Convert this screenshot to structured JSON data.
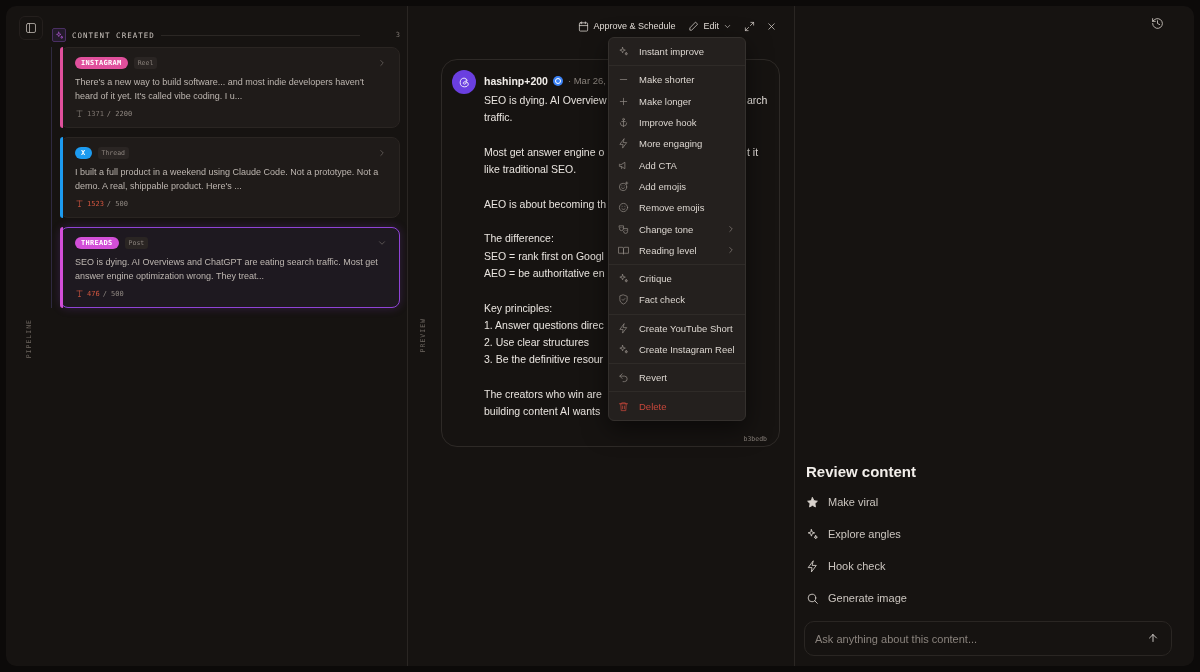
{
  "pipeline": {
    "label": "PIPELINE",
    "section": {
      "title": "CONTENT CREATED",
      "count": "3"
    },
    "cards": [
      {
        "platform": "INSTAGRAM",
        "type": "Reel",
        "color": "#e0509c",
        "selected": false,
        "alert": false,
        "text": "There's a new way to build software... and most indie developers haven't heard of it yet. It's called vibe coding. I u...",
        "count": "1371",
        "limit": "/ 2200"
      },
      {
        "platform": "X",
        "type": "Thread",
        "color": "#1d9bf0",
        "selected": false,
        "alert": true,
        "text": "I built a full product in a weekend using Claude Code. Not a prototype. Not a demo. A real, shippable product. Here's ...",
        "count": "1523",
        "limit": "/ 500"
      },
      {
        "platform": "THREADS",
        "type": "Post",
        "color": "#d24fd8",
        "selected": true,
        "alert": true,
        "text": "SEO is dying. AI Overviews and ChatGPT are eating search traffic. Most get answer engine optimization wrong. They treat...",
        "count": "476",
        "limit": "/ 500"
      }
    ]
  },
  "preview": {
    "label": "PREVIEW",
    "toolbar": {
      "approve": "Approve & Schedule",
      "edit": "Edit"
    },
    "post": {
      "author": "hashinp+200",
      "date": "· Mar 26,",
      "id": "b3bedb",
      "paragraphs": [
        [
          {
            "text": "SEO is dying. AI Overview",
            "tail": "arch"
          },
          {
            "text": "traffic."
          }
        ],
        [
          {
            "text": "Most get answer engine o",
            "tail": "t it"
          },
          {
            "text": "like traditional SEO."
          }
        ],
        [
          {
            "text": "AEO is about becoming th"
          }
        ],
        [
          {
            "text": "The difference:"
          },
          {
            "text": "SEO = rank first on Googl"
          },
          {
            "text": "AEO = be authoritative en"
          }
        ],
        [
          {
            "text": "Key principles:"
          },
          {
            "text": "1. Answer questions direc"
          },
          {
            "text": "2. Use clear structures"
          },
          {
            "text": "3. Be the definitive resour"
          }
        ],
        [
          {
            "text": "The creators who win are"
          },
          {
            "text": "building content AI wants"
          }
        ]
      ]
    },
    "edit_menu": {
      "groups": [
        [
          {
            "label": "Instant improve",
            "kind": "action"
          }
        ],
        [
          {
            "label": "Make shorter",
            "kind": "action"
          },
          {
            "label": "Make longer",
            "kind": "action"
          },
          {
            "label": "Improve hook",
            "kind": "action"
          },
          {
            "label": "More engaging",
            "kind": "action"
          },
          {
            "label": "Add CTA",
            "kind": "action"
          },
          {
            "label": "Add emojis",
            "kind": "action"
          },
          {
            "label": "Remove emojis",
            "kind": "action"
          },
          {
            "label": "Change tone",
            "kind": "submenu"
          },
          {
            "label": "Reading level",
            "kind": "submenu"
          }
        ],
        [
          {
            "label": "Critique",
            "kind": "action"
          },
          {
            "label": "Fact check",
            "kind": "action"
          }
        ],
        [
          {
            "label": "Create YouTube Short",
            "kind": "action"
          },
          {
            "label": "Create Instagram Reel",
            "kind": "action"
          }
        ],
        [
          {
            "label": "Revert",
            "kind": "action"
          }
        ],
        [
          {
            "label": "Delete",
            "kind": "danger"
          }
        ]
      ]
    }
  },
  "review": {
    "title": "Review content",
    "actions": [
      {
        "label": "Make viral"
      },
      {
        "label": "Explore angles"
      },
      {
        "label": "Hook check"
      },
      {
        "label": "Generate image"
      }
    ],
    "input": {
      "placeholder": "Ask anything about this content..."
    }
  }
}
